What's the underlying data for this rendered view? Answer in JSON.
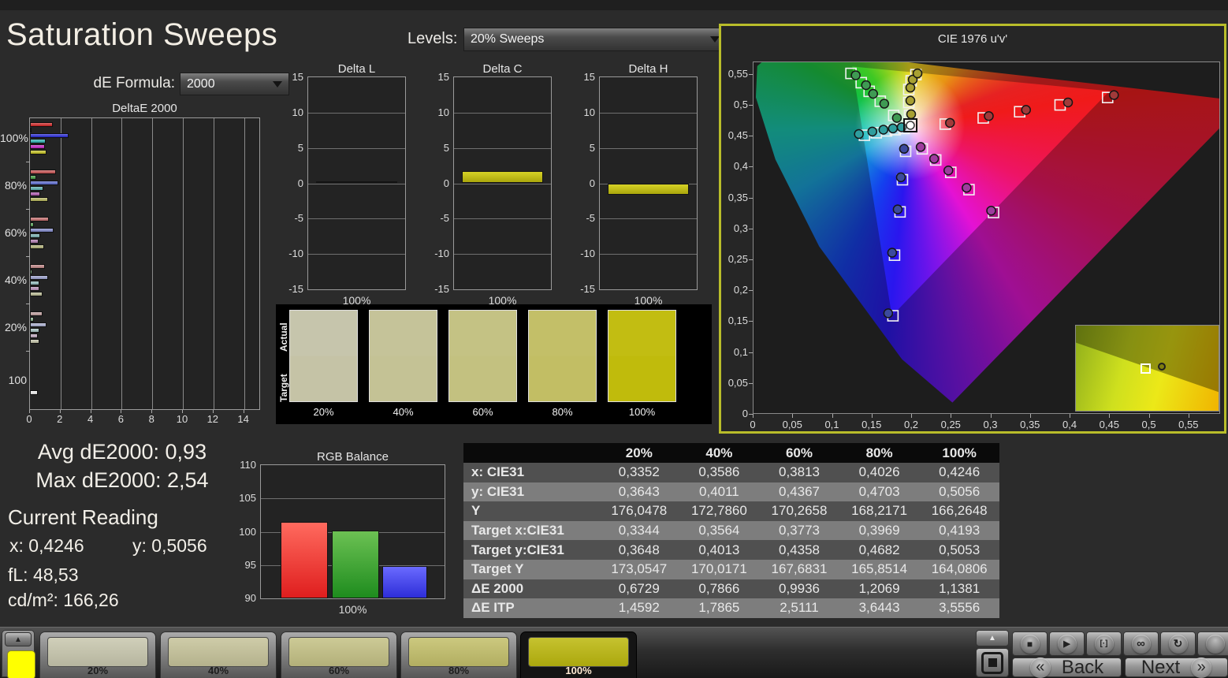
{
  "page": {
    "title": "Saturation Sweeps"
  },
  "controls": {
    "levels_label": "Levels:",
    "levels_value": "20% Sweeps",
    "de_formula_label": "dE Formula:",
    "de_formula_value": "2000"
  },
  "summary": {
    "avg_line": "Avg dE2000: 0,93",
    "max_line": "Max dE2000: 2,54",
    "current_reading_label": "Current Reading",
    "x_line": "x: 0,4246",
    "y_line": "y: 0,5056",
    "fl_line": "fL: 48,53",
    "cdm2_line": "cd/m²: 166,26"
  },
  "chart_data": [
    {
      "id": "deltae_2000",
      "type": "bar",
      "orientation": "horizontal",
      "title": "DeltaE 2000",
      "xlim": [
        0,
        15
      ],
      "xticks": [
        0,
        2,
        4,
        6,
        8,
        10,
        12,
        14
      ],
      "series_labels": [
        "red",
        "green",
        "blue",
        "cyan",
        "magenta",
        "yellow"
      ],
      "groups": [
        {
          "label": "100%",
          "values": [
            1.5,
            0.12,
            2.5,
            1.05,
            1.0,
            1.1
          ],
          "colors": [
            "#d32121",
            "#2f9f3f",
            "#2426da",
            "#28b2b2",
            "#c622c6",
            "#c6c31c"
          ]
        },
        {
          "label": "80%",
          "values": [
            1.7,
            0.4,
            1.85,
            0.9,
            0.65,
            1.2
          ],
          "colors": [
            "#c85050",
            "#3f9f3f",
            "#5868d0",
            "#58b0b0",
            "#b058b0",
            "#b6b65a"
          ]
        },
        {
          "label": "60%",
          "values": [
            1.25,
            0.25,
            1.55,
            0.65,
            0.55,
            0.95
          ],
          "colors": [
            "#c46a6a",
            "#55a055",
            "#8088cc",
            "#78b4b4",
            "#b078b0",
            "#b4b478"
          ]
        },
        {
          "label": "40%",
          "values": [
            1.0,
            0.15,
            1.2,
            0.6,
            0.6,
            0.8
          ],
          "colors": [
            "#c28585",
            "#70a870",
            "#9aa0ce",
            "#90bcbc",
            "#ba90ba",
            "#babb92"
          ]
        },
        {
          "label": "20%",
          "values": [
            0.85,
            0.25,
            1.1,
            0.6,
            0.5,
            0.6
          ],
          "colors": [
            "#c29f9f",
            "#8ab08a",
            "#abb0d2",
            "#a8c4c4",
            "#c0a8c0",
            "#c2c2a6"
          ]
        },
        {
          "label": "100",
          "values": [
            0.5
          ],
          "colors": [
            "#f2f2f2"
          ]
        }
      ]
    },
    {
      "id": "delta_l",
      "type": "bar",
      "title": "Delta L",
      "categories": [
        "100%"
      ],
      "values": [
        0.3
      ],
      "ylim": [
        -15,
        15
      ],
      "yticks": [
        15,
        10,
        5,
        0,
        -5,
        -10,
        -15
      ],
      "bar_color_top": "#d6d226",
      "bar_color_bottom": "#aaa60c"
    },
    {
      "id": "delta_c",
      "type": "bar",
      "title": "Delta C",
      "categories": [
        "100%"
      ],
      "values": [
        1.7
      ],
      "ylim": [
        -15,
        15
      ],
      "yticks": [
        15,
        10,
        5,
        0,
        -5,
        -10,
        -15
      ],
      "bar_color_top": "#d6d226",
      "bar_color_bottom": "#aaa60c"
    },
    {
      "id": "delta_h",
      "type": "bar",
      "title": "Delta H",
      "categories": [
        "100%"
      ],
      "values": [
        -1.6
      ],
      "ylim": [
        -15,
        15
      ],
      "yticks": [
        15,
        10,
        5,
        0,
        -5,
        -10,
        -15
      ],
      "bar_color_top": "#d6d226",
      "bar_color_bottom": "#aaa60c"
    },
    {
      "id": "rgb_balance",
      "type": "bar",
      "title": "RGB Balance",
      "categories": [
        "100%"
      ],
      "ylim": [
        90,
        110
      ],
      "yticks": [
        110,
        105,
        100,
        95,
        90
      ],
      "series": [
        {
          "name": "Red",
          "value": 101.5,
          "color_top": "#ff6a5e",
          "color_bottom": "#df1e1e"
        },
        {
          "name": "Green",
          "value": 100.2,
          "color_top": "#6cc153",
          "color_bottom": "#1e8c1e"
        },
        {
          "name": "Blue",
          "value": 94.9,
          "color_top": "#6a6aff",
          "color_bottom": "#2d2dd8"
        }
      ]
    },
    {
      "id": "cie_1976",
      "type": "scatter",
      "title": "CIE 1976 u'v'",
      "xlim": [
        0,
        0.59
      ],
      "ylim": [
        0,
        0.57
      ],
      "xticks": [
        0,
        0.05,
        0.1,
        0.15,
        0.2,
        0.25,
        0.3,
        0.35,
        0.4,
        0.45,
        0.5,
        0.55
      ],
      "xtick_labels": [
        "0",
        "0,05",
        "0,1",
        "0,15",
        "0,2",
        "0,25",
        "0,3",
        "0,35",
        "0,4",
        "0,45",
        "0,5",
        "0,55"
      ],
      "yticks": [
        0,
        0.05,
        0.1,
        0.15,
        0.2,
        0.25,
        0.3,
        0.35,
        0.4,
        0.45,
        0.5,
        0.55
      ],
      "ytick_labels": [
        "0",
        "0,05",
        "0,1",
        "0,15",
        "0,2",
        "0,25",
        "0,3",
        "0,35",
        "0,4",
        "0,45",
        "0,5",
        "0,55"
      ],
      "white_point": [
        0.198,
        0.468
      ],
      "sweeps": [
        {
          "name": "red",
          "dot_color": "#a13a3a",
          "targets": [
            [
              0.242,
              0.47
            ],
            [
              0.29,
              0.48
            ],
            [
              0.336,
              0.49
            ],
            [
              0.387,
              0.501
            ],
            [
              0.447,
              0.513
            ]
          ],
          "measured": [
            [
              0.248,
              0.472
            ],
            [
              0.297,
              0.483
            ],
            [
              0.344,
              0.493
            ],
            [
              0.397,
              0.505
            ],
            [
              0.455,
              0.517
            ]
          ]
        },
        {
          "name": "green",
          "dot_color": "#3f9a53",
          "targets": [
            [
              0.177,
              0.484
            ],
            [
              0.16,
              0.507
            ],
            [
              0.146,
              0.523
            ],
            [
              0.136,
              0.537
            ],
            [
              0.123,
              0.552
            ]
          ],
          "measured": [
            [
              0.181,
              0.48
            ],
            [
              0.165,
              0.503
            ],
            [
              0.151,
              0.519
            ],
            [
              0.142,
              0.533
            ],
            [
              0.129,
              0.549
            ]
          ]
        },
        {
          "name": "blue",
          "dot_color": "#3c4a9e",
          "targets": [
            [
              0.192,
              0.426
            ],
            [
              0.188,
              0.38
            ],
            [
              0.185,
              0.328
            ],
            [
              0.178,
              0.258
            ],
            [
              0.176,
              0.16
            ]
          ],
          "measured": [
            [
              0.19,
              0.43
            ],
            [
              0.186,
              0.384
            ],
            [
              0.182,
              0.332
            ],
            [
              0.175,
              0.262
            ],
            [
              0.17,
              0.164
            ]
          ]
        },
        {
          "name": "cyan",
          "dot_color": "#2f9e9e",
          "targets": [
            [
              0.19,
              0.463
            ],
            [
              0.179,
              0.461
            ],
            [
              0.168,
              0.459
            ],
            [
              0.155,
              0.456
            ],
            [
              0.14,
              0.452
            ]
          ],
          "measured": [
            [
              0.187,
              0.465
            ],
            [
              0.176,
              0.463
            ],
            [
              0.164,
              0.461
            ],
            [
              0.15,
              0.458
            ],
            [
              0.133,
              0.454
            ]
          ]
        },
        {
          "name": "magenta",
          "dot_color": "#9e3c9e",
          "targets": [
            [
              0.213,
              0.43
            ],
            [
              0.23,
              0.412
            ],
            [
              0.249,
              0.392
            ],
            [
              0.272,
              0.364
            ],
            [
              0.303,
              0.327
            ]
          ],
          "measured": [
            [
              0.211,
              0.433
            ],
            [
              0.228,
              0.414
            ],
            [
              0.246,
              0.395
            ],
            [
              0.269,
              0.367
            ],
            [
              0.3,
              0.33
            ]
          ]
        },
        {
          "name": "yellow",
          "dot_color": "#a8a032",
          "targets": [
            [
              0.197,
              0.484
            ],
            [
              0.196,
              0.505
            ],
            [
              0.196,
              0.526
            ],
            [
              0.199,
              0.54
            ],
            [
              0.205,
              0.55
            ]
          ],
          "measured": [
            [
              0.199,
              0.486
            ],
            [
              0.198,
              0.508
            ],
            [
              0.198,
              0.529
            ],
            [
              0.201,
              0.542
            ],
            [
              0.207,
              0.552
            ]
          ]
        }
      ],
      "inset": {
        "square_frac": [
          0.48,
          0.49
        ],
        "circle_frac": [
          0.595,
          0.475
        ]
      }
    }
  ],
  "swatch_panel": {
    "row_labels": [
      "Actual",
      "Target"
    ],
    "items": [
      {
        "label": "20%",
        "actual": "#c6c5ac",
        "target": "#c5c3a6"
      },
      {
        "label": "40%",
        "actual": "#c5c399",
        "target": "#c4c295"
      },
      {
        "label": "60%",
        "actual": "#c4c284",
        "target": "#c3c180"
      },
      {
        "label": "80%",
        "actual": "#c3bf68",
        "target": "#c2be64"
      },
      {
        "label": "100%",
        "actual": "#c2bd12",
        "target": "#c0bb0c"
      }
    ]
  },
  "table": {
    "headers": [
      "",
      "20%",
      "40%",
      "60%",
      "80%",
      "100%"
    ],
    "rows": [
      {
        "label": "x: CIE31",
        "values": [
          "0,3352",
          "0,3586",
          "0,3813",
          "0,4026",
          "0,4246"
        ]
      },
      {
        "label": "y: CIE31",
        "values": [
          "0,3643",
          "0,4011",
          "0,4367",
          "0,4703",
          "0,5056"
        ]
      },
      {
        "label": "Y",
        "values": [
          "176,0478",
          "172,7860",
          "170,2658",
          "168,2171",
          "166,2648"
        ]
      },
      {
        "label": "Target x:CIE31",
        "values": [
          "0,3344",
          "0,3564",
          "0,3773",
          "0,3969",
          "0,4193"
        ]
      },
      {
        "label": "Target y:CIE31",
        "values": [
          "0,3648",
          "0,4013",
          "0,4358",
          "0,4682",
          "0,5053"
        ]
      },
      {
        "label": "Target Y",
        "values": [
          "173,0547",
          "170,0171",
          "167,6831",
          "165,8514",
          "164,0806"
        ]
      },
      {
        "label": "ΔE 2000",
        "values": [
          "0,6729",
          "0,7866",
          "0,9936",
          "1,2069",
          "1,1381"
        ]
      },
      {
        "label": "ΔE ITP",
        "values": [
          "1,4592",
          "1,7865",
          "2,5111",
          "3,6443",
          "3,5556"
        ]
      }
    ]
  },
  "taskbar": {
    "reference_swatch_color": "#ffff00",
    "patches": [
      {
        "label": "20%",
        "color": "#c9c8af",
        "selected": false
      },
      {
        "label": "40%",
        "color": "#c7c49b",
        "selected": false
      },
      {
        "label": "60%",
        "color": "#c5c286",
        "selected": false
      },
      {
        "label": "80%",
        "color": "#c4c06b",
        "selected": false
      },
      {
        "label": "100%",
        "color": "#bdb90f",
        "selected": true
      }
    ],
    "transport": [
      {
        "name": "stop",
        "glyph": "■"
      },
      {
        "name": "play",
        "glyph": "▶"
      },
      {
        "name": "measure",
        "glyph": "[·]"
      },
      {
        "name": "continuous",
        "glyph": "∞"
      },
      {
        "name": "refresh",
        "glyph": "↻"
      },
      {
        "name": "blank",
        "glyph": ""
      }
    ],
    "nav": {
      "back_label": "Back",
      "back_icon": "«",
      "next_label": "Next",
      "next_icon": "»"
    },
    "up_arrow": "▲"
  }
}
